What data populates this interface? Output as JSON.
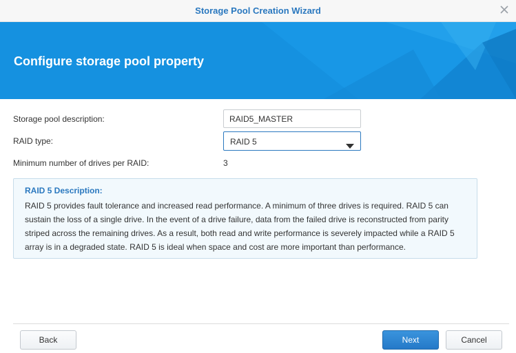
{
  "window": {
    "title": "Storage Pool Creation Wizard",
    "close_icon": "close-icon"
  },
  "banner": {
    "heading": "Configure storage pool property",
    "color": "#1591e0"
  },
  "form": {
    "description_label": "Storage pool description:",
    "description_value": "RAID5_MASTER",
    "raid_type_label": "RAID type:",
    "raid_type_value": "RAID 5",
    "min_drives_label": "Minimum number of drives per RAID:",
    "min_drives_value": "3"
  },
  "info": {
    "title": "RAID 5 Description:",
    "text": "RAID 5 provides fault tolerance and increased read performance. A minimum of three drives is required. RAID 5 can sustain the loss of a single drive. In the event of a drive failure, data from the failed drive is reconstructed from parity striped across the remaining drives. As a result, both read and write performance is severely impacted while a RAID 5 array is in a degraded state. RAID 5 is ideal when space and cost are more important than performance."
  },
  "footer": {
    "back_label": "Back",
    "next_label": "Next",
    "cancel_label": "Cancel"
  },
  "colors": {
    "accent": "#2a78bf",
    "primary_button": "#2a82cf"
  }
}
